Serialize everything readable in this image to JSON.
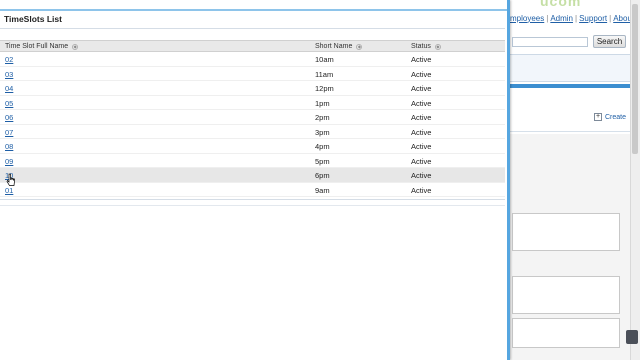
{
  "background_page": {
    "top_nav": [
      "mployees",
      "Admin",
      "Support",
      "About"
    ],
    "search_button": "Search",
    "create_link": "Create"
  },
  "popup": {
    "title": "TimeSlots List",
    "columns": [
      "Time Slot Full Name",
      "Short Name",
      "Status"
    ],
    "rows": [
      {
        "name": "02",
        "short": "10am",
        "status": "Active"
      },
      {
        "name": "03",
        "short": "11am",
        "status": "Active"
      },
      {
        "name": "04",
        "short": "12pm",
        "status": "Active"
      },
      {
        "name": "05",
        "short": "1pm",
        "status": "Active"
      },
      {
        "name": "06",
        "short": "2pm",
        "status": "Active"
      },
      {
        "name": "07",
        "short": "3pm",
        "status": "Active"
      },
      {
        "name": "08",
        "short": "4pm",
        "status": "Active"
      },
      {
        "name": "09",
        "short": "5pm",
        "status": "Active"
      },
      {
        "name": "10",
        "short": "6pm",
        "status": "Active"
      },
      {
        "name": "01",
        "short": "9am",
        "status": "Active"
      }
    ]
  },
  "colors": {
    "accent": "#56a6e0",
    "link": "#1f5fa6",
    "header_bg": "#e9e9e9"
  },
  "icons": [
    "sort-icon",
    "plus-icon",
    "pointer-cursor-icon"
  ]
}
